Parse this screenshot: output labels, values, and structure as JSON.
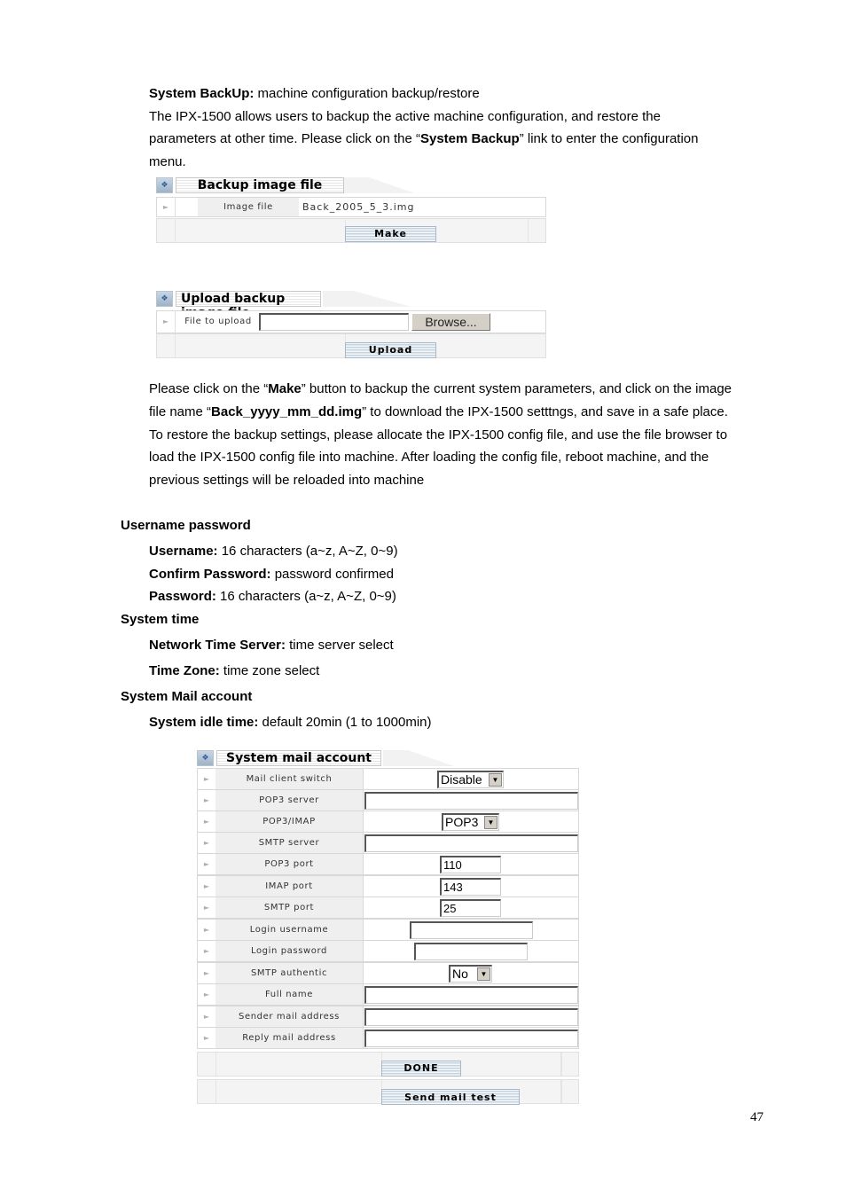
{
  "intro": {
    "heading_bold": "System BackUp:",
    "heading_rest": " machine configuration backup/restore",
    "line1": "The IPX-1500 allows users to backup the active machine configuration, and restore the",
    "line2_pre": "parameters at other time. Please click on the “",
    "line2_bold": "System Backup",
    "line2_post": "” link to enter the configuration",
    "line3": "menu."
  },
  "backup_panel": {
    "title": "Backup image file",
    "row_label": "Image file",
    "file_link": "Back_2005_5_3.img",
    "make_button": "Make"
  },
  "upload_panel": {
    "title": "Upload backup image file",
    "row_label": "File to upload",
    "file_value": "",
    "browse_button": "Browse...",
    "upload_button": "Upload"
  },
  "explain": {
    "l1_pre": "Please click on the “",
    "l1_bold": "Make",
    "l1_post": "” button to backup the current system parameters, and click on the image",
    "l2_pre": "file name “",
    "l2_bold": "Back_yyyy_mm_dd.img",
    "l2_post": "” to download the IPX-1500 setttngs, and save in a safe place.",
    "l3": "To restore the backup settings, please allocate the IPX-1500 config file, and use the file browser to",
    "l4": "load the IPX-1500 config file into machine. After loading the config file, reboot machine, and the",
    "l5": "previous settings will be reloaded into machine"
  },
  "sections": {
    "username_password": {
      "heading": "Username password",
      "items": [
        {
          "label": "Username:",
          "text": " 16 characters (a~z, A~Z, 0~9)"
        },
        {
          "label": "Confirm Password:",
          "text": " password confirmed"
        },
        {
          "label": "Password:",
          "text": " 16 characters (a~z, A~Z, 0~9)"
        }
      ]
    },
    "system_time": {
      "heading": "System time",
      "items": [
        {
          "label": "Network Time Server:",
          "text": " time server select"
        },
        {
          "label": "Time Zone:",
          "text": " time zone select"
        }
      ]
    },
    "system_mail": {
      "heading": "System Mail account",
      "items": [
        {
          "label": "System idle time:",
          "text": " default 20min (1 to 1000min)"
        }
      ]
    }
  },
  "mail_panel": {
    "title": "System mail account",
    "rows": [
      {
        "label": "Mail client switch",
        "type": "select",
        "value": "Disable"
      },
      {
        "label": "POP3 server",
        "type": "text",
        "value": ""
      },
      {
        "label": "POP3/IMAP",
        "type": "select",
        "value": "POP3"
      },
      {
        "label": "SMTP server",
        "type": "text",
        "value": ""
      },
      {
        "label": "POP3 port",
        "type": "text",
        "value": "110"
      },
      {
        "label": "IMAP port",
        "type": "text",
        "value": "143"
      },
      {
        "label": "SMTP port",
        "type": "text",
        "value": "25"
      },
      {
        "label": "Login username",
        "type": "text",
        "value": ""
      },
      {
        "label": "Login password",
        "type": "password",
        "value": ""
      },
      {
        "label": "SMTP authentic",
        "type": "select",
        "value": "No"
      },
      {
        "label": "Full name",
        "type": "text",
        "value": ""
      },
      {
        "label": "Sender mail address",
        "type": "text",
        "value": ""
      },
      {
        "label": "Reply mail address",
        "type": "text",
        "value": ""
      }
    ],
    "done_button": "DONE",
    "send_test_button": "Send mail test"
  },
  "icons": {
    "panel_icon": "expand-arrows-icon",
    "row_bullet": "triangle-right-icon",
    "dropdown": "chevron-down-icon"
  },
  "page_number": "47"
}
